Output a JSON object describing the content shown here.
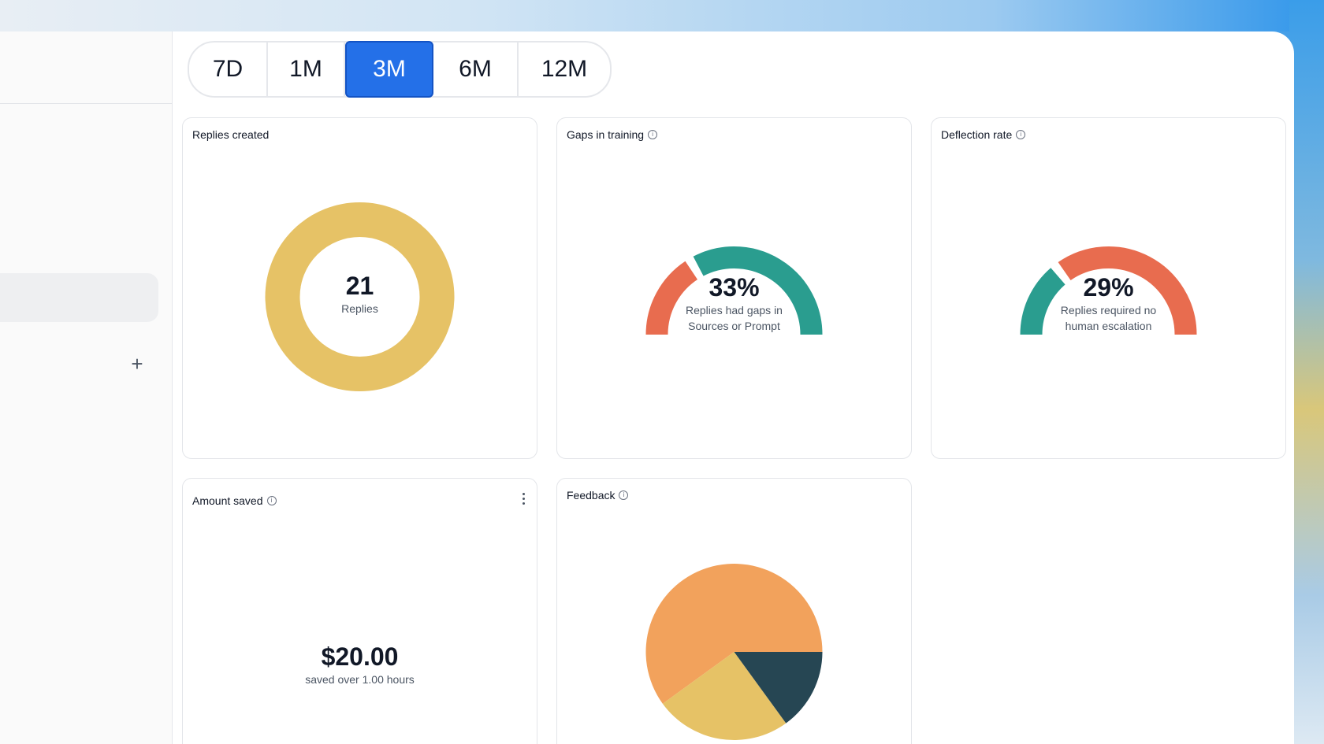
{
  "range": {
    "options": [
      "7D",
      "1M",
      "3M",
      "6M",
      "12M"
    ],
    "selected": "3M"
  },
  "sidebar": {
    "add_icon": "plus-icon"
  },
  "cards": {
    "replies": {
      "title": "Replies created",
      "value": "21",
      "label": "Replies",
      "color": "#e6c266"
    },
    "gaps": {
      "title": "Gaps in training",
      "value": "33%",
      "label_line1": "Replies had gaps in",
      "label_line2": "Sources or Prompt",
      "fraction": 0.33,
      "colors": {
        "filled": "#e86c4f",
        "rest": "#2a9d8f"
      }
    },
    "deflection": {
      "title": "Deflection rate",
      "value": "29%",
      "label_line1": "Replies required no",
      "label_line2": "human escalation",
      "fraction": 0.29,
      "colors": {
        "filled": "#2a9d8f",
        "rest": "#e86c4f"
      }
    },
    "amount": {
      "title": "Amount saved",
      "value": "$20.00",
      "label": "saved over 1.00 hours"
    },
    "feedback": {
      "title": "Feedback"
    }
  },
  "chart_data": {
    "type": "pie",
    "values": [
      60,
      25,
      15
    ],
    "colors": [
      "#f2a25c",
      "#e6c266",
      "#264653"
    ]
  }
}
